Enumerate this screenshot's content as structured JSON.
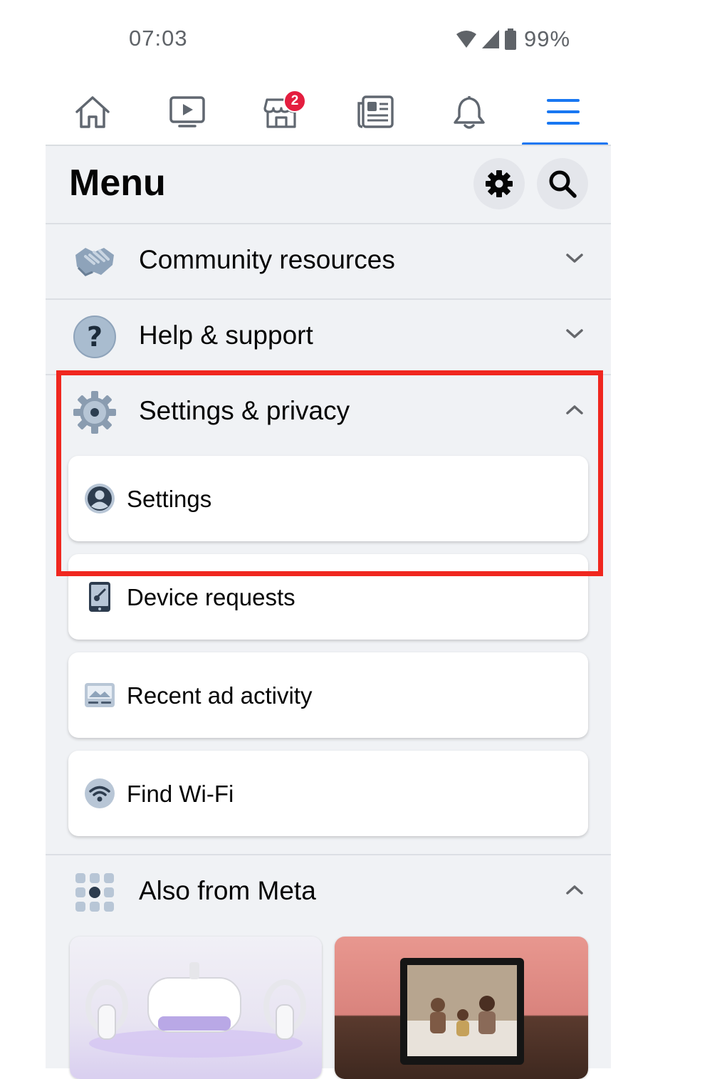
{
  "status_bar": {
    "time": "07:03",
    "battery": "99%"
  },
  "nav": {
    "items": [
      {
        "name": "home-tab",
        "icon": "home-icon"
      },
      {
        "name": "watch-tab",
        "icon": "video-play-icon"
      },
      {
        "name": "marketplace-tab",
        "icon": "shop-icon",
        "badge": "2"
      },
      {
        "name": "news-tab",
        "icon": "newspaper-icon"
      },
      {
        "name": "notifications-tab",
        "icon": "bell-icon"
      },
      {
        "name": "menu-tab",
        "icon": "hamburger-icon",
        "active": true
      }
    ],
    "accent": "#1877f2"
  },
  "header": {
    "title": "Menu"
  },
  "sections": {
    "community": {
      "label": "Community resources",
      "icon": "handshake-icon",
      "expanded": false
    },
    "help": {
      "label": "Help & support",
      "icon": "question-icon",
      "expanded": false
    },
    "settings_privacy": {
      "label": "Settings & privacy",
      "icon": "gear-icon",
      "expanded": true,
      "items": [
        {
          "label": "Settings",
          "icon": "profile-icon"
        },
        {
          "label": "Device requests",
          "icon": "phone-key-icon"
        },
        {
          "label": "Recent ad activity",
          "icon": "image-ad-icon"
        },
        {
          "label": "Find Wi-Fi",
          "icon": "wifi-icon"
        }
      ]
    },
    "also_from_meta": {
      "label": "Also from Meta",
      "icon": "apps-grid-icon",
      "expanded": true
    }
  },
  "highlight_color": "#f0271f"
}
